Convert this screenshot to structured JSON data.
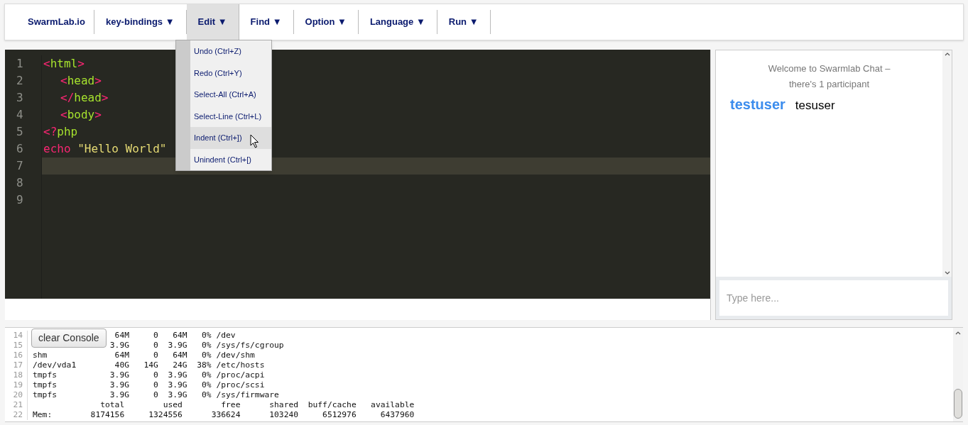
{
  "navbar": {
    "brand": "SwarmLab.io",
    "menus": [
      {
        "label": "key-bindings ▼",
        "selected": false
      },
      {
        "label": "Edit ▼",
        "selected": true
      },
      {
        "label": "Find ▼",
        "selected": false
      },
      {
        "label": "Option ▼",
        "selected": false
      },
      {
        "label": "Language ▼",
        "selected": false
      },
      {
        "label": "Run ▼",
        "selected": false
      }
    ]
  },
  "edit_menu": {
    "items": [
      {
        "label": "Undo (Ctrl+Z)",
        "selected": false
      },
      {
        "label": "Redo (Ctrl+Y)",
        "selected": false
      },
      {
        "label": "Select-All (Ctrl+A)",
        "selected": false
      },
      {
        "label": "Select-Line (Ctrl+L)",
        "selected": false
      },
      {
        "label": "Indent (Ctrl+])",
        "selected": true
      },
      {
        "label": "Unindent (Ctrl+[)",
        "selected": false
      }
    ]
  },
  "editor": {
    "lines": [
      {
        "number": "1",
        "active": false,
        "indented": false,
        "tokens": [
          {
            "kind": "punct",
            "text": "<"
          },
          {
            "kind": "tag",
            "text": "html"
          },
          {
            "kind": "punct",
            "text": ">"
          }
        ]
      },
      {
        "number": "2",
        "active": false,
        "indented": true,
        "tokens": [
          {
            "kind": "punct",
            "text": "<"
          },
          {
            "kind": "tag",
            "text": "head"
          },
          {
            "kind": "punct",
            "text": ">"
          }
        ]
      },
      {
        "number": "3",
        "active": false,
        "indented": true,
        "tokens": [
          {
            "kind": "punct",
            "text": "</"
          },
          {
            "kind": "tag",
            "text": "head"
          },
          {
            "kind": "punct",
            "text": ">"
          }
        ]
      },
      {
        "number": "4",
        "active": false,
        "indented": true,
        "tokens": [
          {
            "kind": "punct",
            "text": "<"
          },
          {
            "kind": "tag",
            "text": "body"
          },
          {
            "kind": "punct",
            "text": ">"
          }
        ]
      },
      {
        "number": "5",
        "active": false,
        "indented": false,
        "tokens": [
          {
            "kind": "punct",
            "text": "<?"
          },
          {
            "kind": "tag",
            "text": "php"
          }
        ]
      },
      {
        "number": "6",
        "active": false,
        "indented": false,
        "tokens": [
          {
            "kind": "keyword",
            "text": "echo"
          },
          {
            "kind": "string",
            "text": " \"Hello World\""
          }
        ]
      },
      {
        "number": "7",
        "active": true
      },
      {
        "number": "8",
        "active": false
      },
      {
        "number": "9",
        "active": false
      }
    ]
  },
  "chat": {
    "welcome": "Welcome to Swarmlab Chat –",
    "participants_note": "there's 1 participant",
    "users": [
      {
        "name": "testuser",
        "kind": "self"
      },
      {
        "name": "tesuser",
        "kind": "other"
      }
    ],
    "input": {
      "placeholder": "Type here..."
    }
  },
  "console": {
    "clear_button": "clear Console",
    "lines": [
      {
        "number": "14",
        "kind": "covered",
        "text": " 64M     0   64M   0% /dev"
      },
      {
        "number": "15",
        "kind": "covered",
        "text": "3.9G     0  3.9G   0% /sys/fs/cgroup"
      },
      {
        "number": "16",
        "text": "shm              64M     0   64M   0% /dev/shm"
      },
      {
        "number": "17",
        "text": "/dev/vda1        40G   14G   24G  38% /etc/hosts"
      },
      {
        "number": "18",
        "text": "tmpfs           3.9G     0  3.9G   0% /proc/acpi"
      },
      {
        "number": "19",
        "text": "tmpfs           3.9G     0  3.9G   0% /proc/scsi"
      },
      {
        "number": "20",
        "text": "tmpfs           3.9G     0  3.9G   0% /sys/firmware"
      },
      {
        "number": "21",
        "text": "              total        used        free      shared  buff/cache   available"
      },
      {
        "number": "22",
        "text": "Mem:        8174156     1324556      336624      103240     6512976     6437960"
      }
    ]
  }
}
